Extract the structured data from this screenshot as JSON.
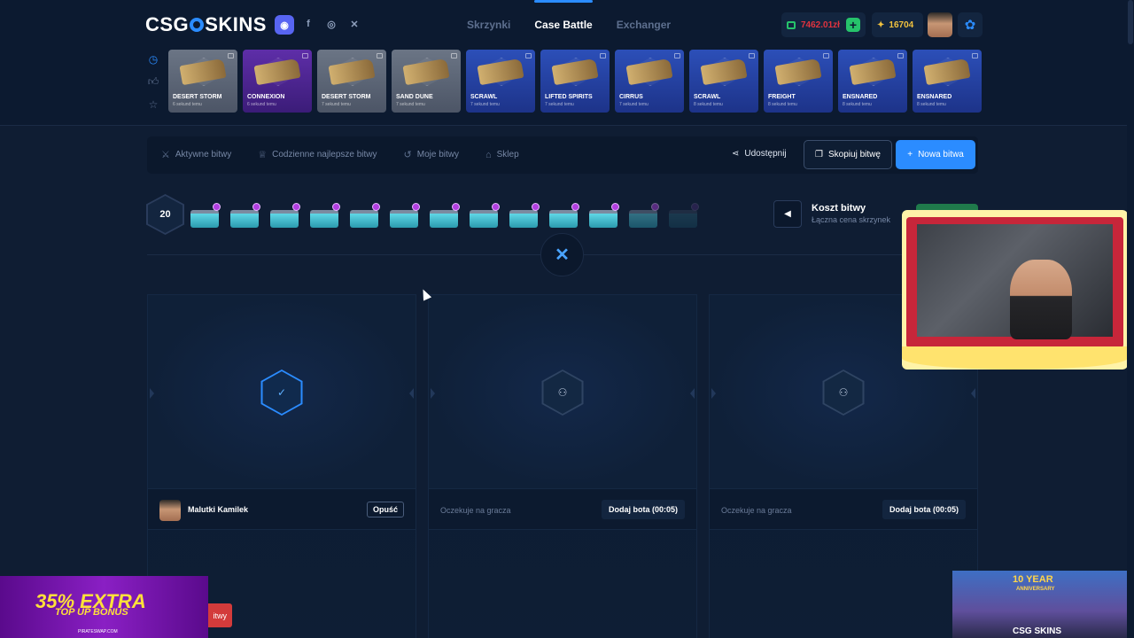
{
  "header": {
    "logo_left": "CSG",
    "logo_right": "SKINS",
    "socials": [
      "discord-icon",
      "facebook-icon",
      "instagram-icon",
      "x-icon"
    ],
    "nav": [
      {
        "label": "Skrzynki",
        "active": false
      },
      {
        "label": "Case Battle",
        "active": true
      },
      {
        "label": "Exchanger",
        "active": false
      }
    ],
    "balance": "7462.01zł",
    "points": "16704",
    "accent": "#2b8cff"
  },
  "recent_drops": [
    {
      "name": "DESERT STORM",
      "time": "6 sekund temu",
      "rarity": "gray"
    },
    {
      "name": "CONNEXION",
      "time": "6 sekund temu",
      "rarity": "purple"
    },
    {
      "name": "DESERT STORM",
      "time": "7 sekund temu",
      "rarity": "gray"
    },
    {
      "name": "SAND DUNE",
      "time": "7 sekund temu",
      "rarity": "gray"
    },
    {
      "name": "SCRAWL",
      "time": "7 sekund temu",
      "rarity": "blue"
    },
    {
      "name": "LIFTED SPIRITS",
      "time": "7 sekund temu",
      "rarity": "blue"
    },
    {
      "name": "CIRRUS",
      "time": "7 sekund temu",
      "rarity": "blue"
    },
    {
      "name": "SCRAWL",
      "time": "8 sekund temu",
      "rarity": "blue"
    },
    {
      "name": "FREIGHT",
      "time": "8 sekund temu",
      "rarity": "blue"
    },
    {
      "name": "ENSNARED",
      "time": "8 sekund temu",
      "rarity": "blue"
    },
    {
      "name": "ENSNARED",
      "time": "8 sekund temu",
      "rarity": "blue"
    }
  ],
  "toolbar": {
    "tabs": [
      {
        "label": "Aktywne bitwy",
        "icon": "swords-icon"
      },
      {
        "label": "Codzienne najlepsze bitwy",
        "icon": "trophy-icon"
      },
      {
        "label": "Moje bitwy",
        "icon": "history-icon"
      },
      {
        "label": "Sklep",
        "icon": "basket-icon"
      }
    ],
    "share_label": "Udostępnij",
    "copy_label": "Skopiuj bitwę",
    "new_label": "Nowa bitwa"
  },
  "battle": {
    "rounds": "20",
    "case_count": 13,
    "cost_title": "Koszt bitwy",
    "cost_sub": "Łączna cena skrzynek"
  },
  "players": [
    {
      "slot": 1,
      "state": "joined",
      "name": "Malutki Kamilek",
      "leave_label": "Opuść"
    },
    {
      "slot": 2,
      "state": "waiting",
      "waiting_label": "Oczekuje na gracza",
      "addbot_label": "Dodaj bota (00:05)"
    },
    {
      "slot": 3,
      "state": "waiting",
      "waiting_label": "Oczekuje na gracza",
      "addbot_label": "Dodaj bota (00:05)"
    }
  ],
  "overlays": {
    "promo_big": "35% EXTRA",
    "promo_small": "TOP UP BONUS",
    "promo_site": "PIRATESWAP.COM",
    "red_button": "itwy",
    "anniv_title": "10 YEAR",
    "anniv_sub": "ANNIVERSARY",
    "anniv_brand": "CSG SKINS"
  }
}
